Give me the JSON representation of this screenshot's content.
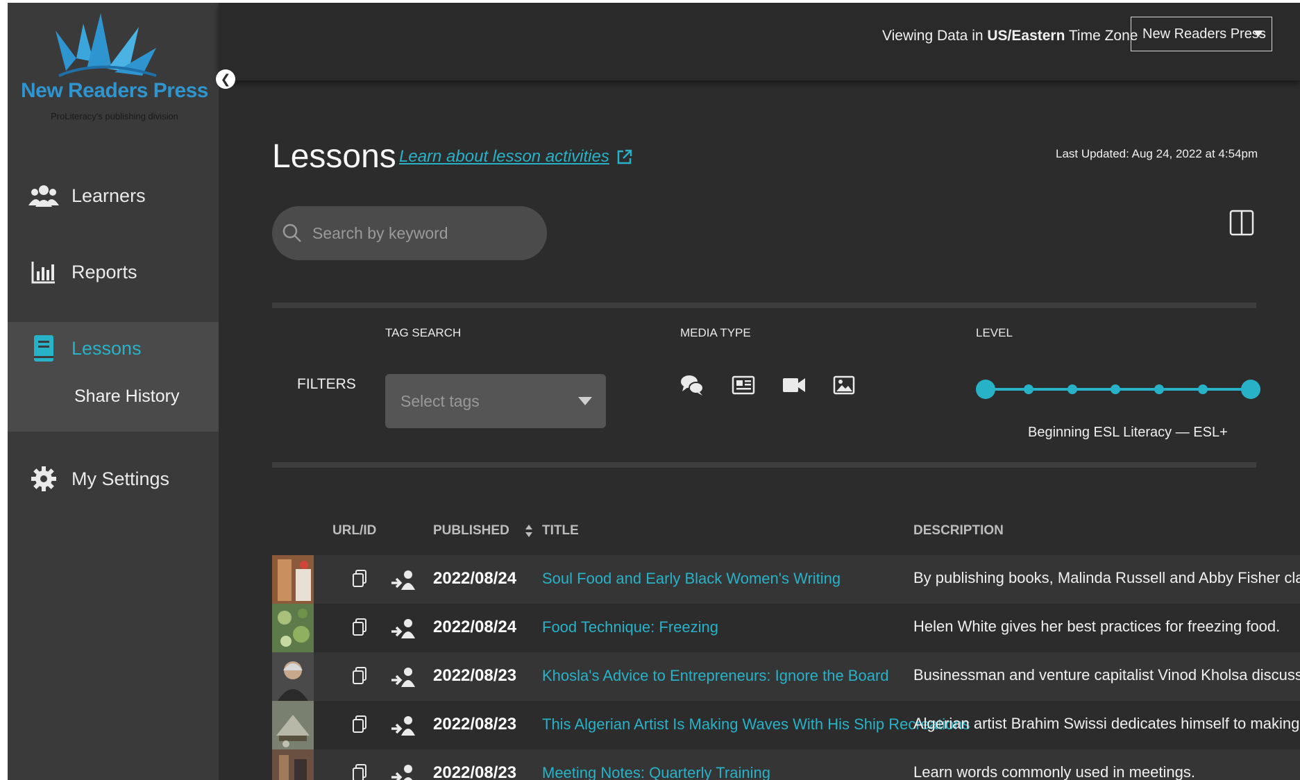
{
  "brand": {
    "name": "New Readers Press",
    "tagline": "ProLiteracy's publishing division",
    "colors": {
      "accent": "#27b2c8",
      "logo": "#2f95d0",
      "background": "#2c2c2c",
      "sidebar": "#3a3a3a"
    }
  },
  "sidebar": {
    "items": [
      {
        "label": "Learners",
        "icon": "users-icon"
      },
      {
        "label": "Reports",
        "icon": "bar-chart-icon"
      },
      {
        "label": "Lessons",
        "icon": "book-icon"
      },
      {
        "label": "My Settings",
        "icon": "gear-icon"
      }
    ],
    "sub_item": "Share History"
  },
  "topbar": {
    "tz_prefix": "Viewing Data in ",
    "tz_value": "US/Eastern",
    "tz_suffix": " Time Zone",
    "org_select": "New Readers Press"
  },
  "main": {
    "title": "Lessons",
    "learn_link": "Learn about lesson activities",
    "last_updated": "Last Updated: Aug 24, 2022 at 4:54pm",
    "search_placeholder": "Search by keyword"
  },
  "filters": {
    "label": "FILTERS",
    "tag_search_label": "TAG SEARCH",
    "tag_placeholder": "Select tags",
    "media_type_label": "MEDIA TYPE",
    "media_icons": [
      "chat-bubbles-icon",
      "article-icon",
      "video-camera-icon",
      "image-icon"
    ],
    "level_label": "LEVEL",
    "level_range": "Beginning ESL Literacy — ESL+",
    "level_selected_fraction": [
      0,
      1
    ]
  },
  "table": {
    "headers": {
      "url_id": "URL/ID",
      "published": "PUBLISHED",
      "title": "TITLE",
      "description": "DESCRIPTION"
    },
    "rows": [
      {
        "date": "2022/08/24",
        "title": "Soul Food and Early Black Women's Writing",
        "description": "By publishing books, Malinda Russell and Abby Fisher claimed an au"
      },
      {
        "date": "2022/08/24",
        "title": "Food Technique: Freezing",
        "description": "Helen White gives her best practices for freezing food."
      },
      {
        "date": "2022/08/23",
        "title": "Khosla's Advice to Entrepreneurs: Ignore the Board",
        "description": "Businessman and venture capitalist Vinod Kholsa discusses the role of"
      },
      {
        "date": "2022/08/23",
        "title": "This Algerian Artist Is Making Waves With His Ship Recreations",
        "description": "Algerian artist Brahim Swissi dedicates himself to making ship models"
      },
      {
        "date": "2022/08/23",
        "title": "Meeting Notes: Quarterly Training",
        "description": "Learn words commonly used in meetings."
      }
    ]
  }
}
